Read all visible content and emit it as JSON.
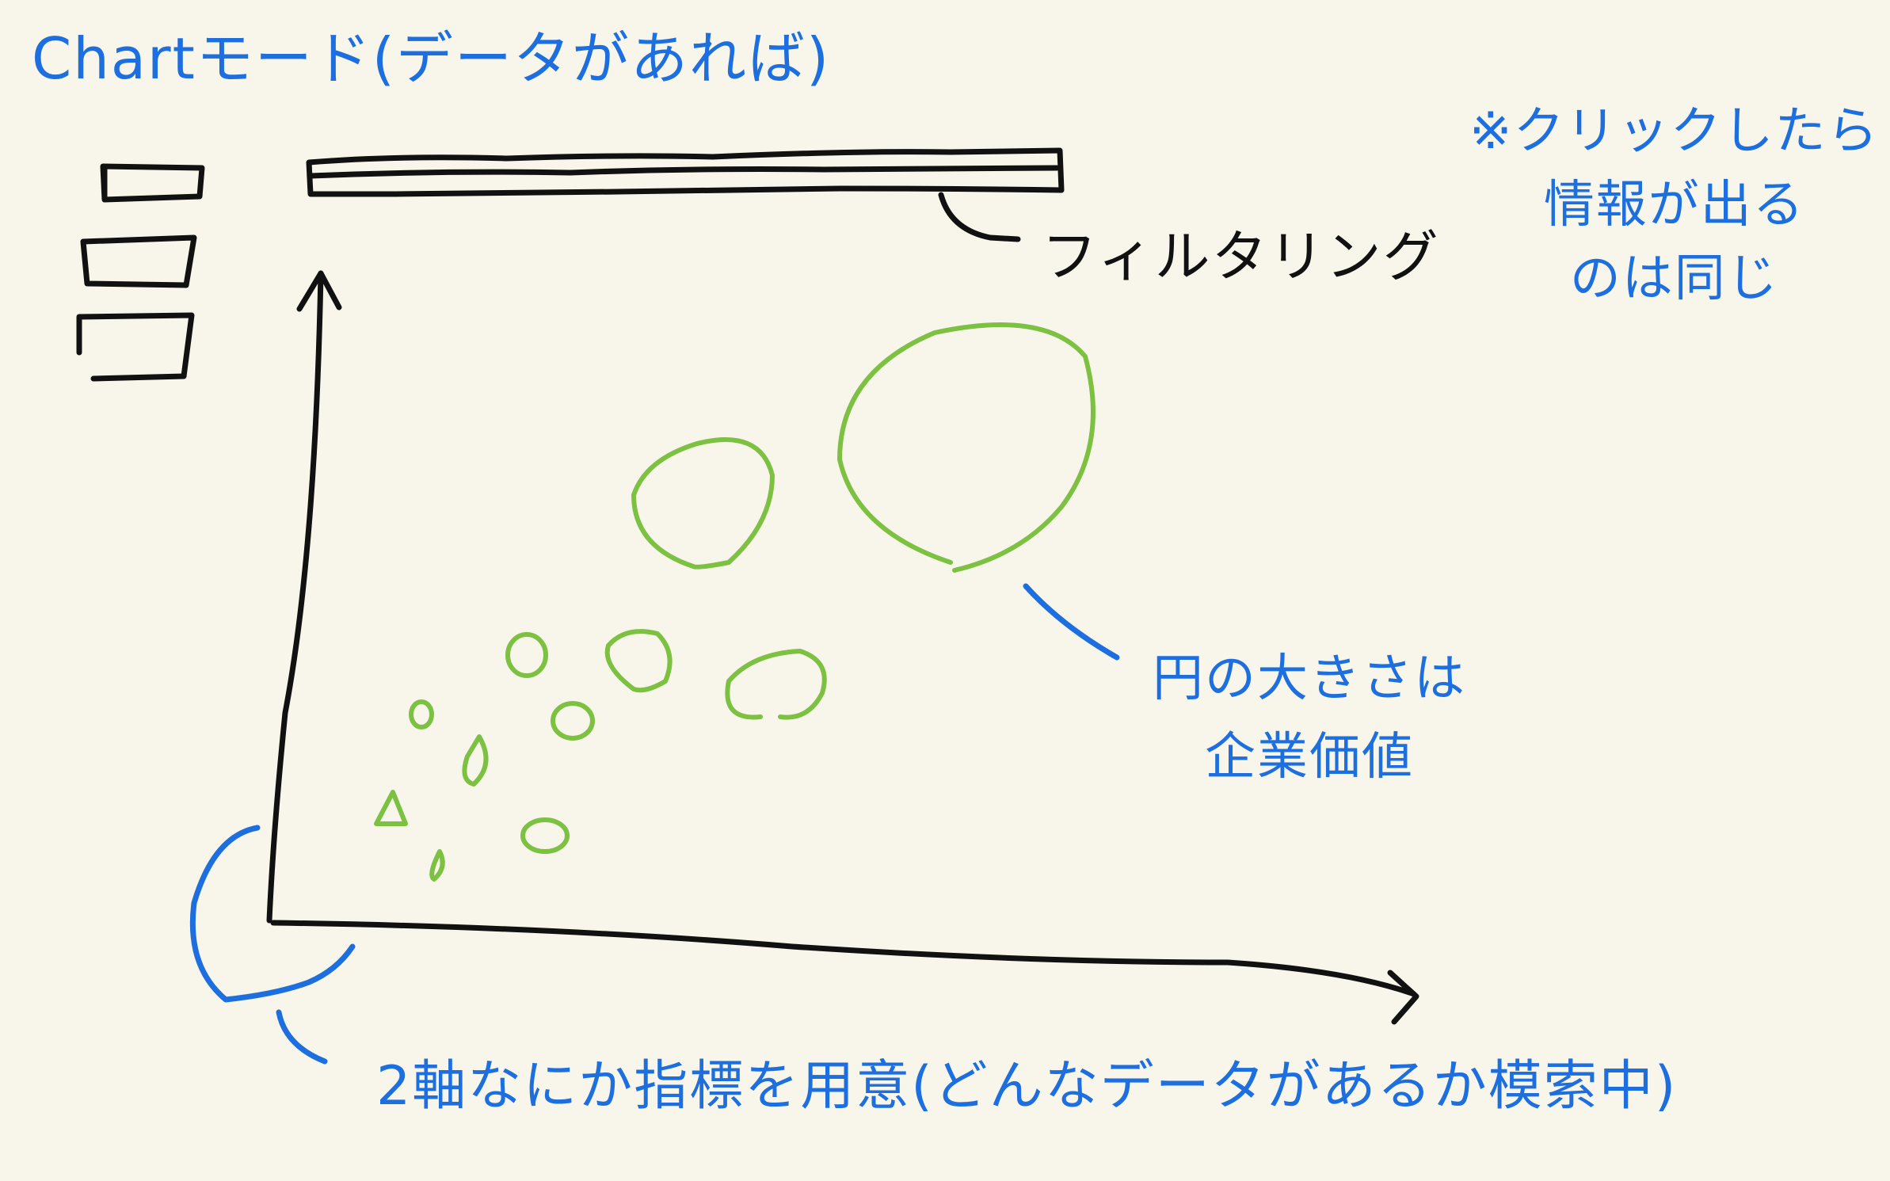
{
  "texts": {
    "title": "Chartモード(データがあれば)",
    "filter_label": "フィルタリング",
    "click_note": [
      "※クリックしたら",
      "情報が出る",
      "のは同じ"
    ],
    "circle_note": [
      "円の大きさは",
      "企業価値"
    ],
    "axis_note": "2軸なにか指標を用意(どんなデータがあるか模索中)"
  },
  "colors": {
    "ink": "#111111",
    "note": "#1d6fe0",
    "bubble": "#7cc142",
    "paper": "#f8f6ea"
  },
  "bubbles": [
    {
      "size": "large"
    },
    {
      "size": "large"
    },
    {
      "size": "medium"
    },
    {
      "size": "medium"
    },
    {
      "size": "small"
    },
    {
      "size": "small"
    },
    {
      "size": "small"
    },
    {
      "size": "small"
    },
    {
      "size": "small"
    },
    {
      "size": "small"
    },
    {
      "size": "small"
    }
  ]
}
